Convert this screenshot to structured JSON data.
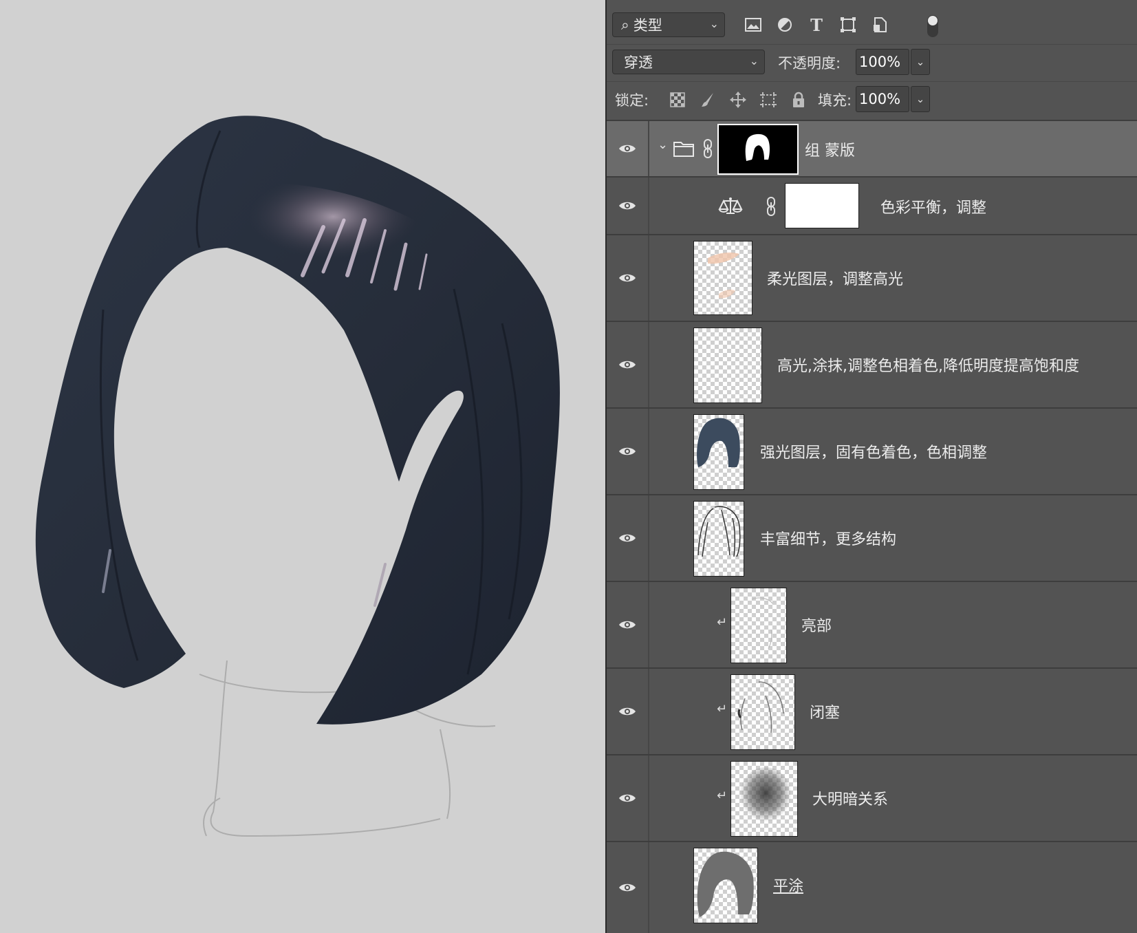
{
  "canvas": {
    "background": "#d1d1d1",
    "hair_color": "#2b3442"
  },
  "toolbar": {
    "filter_kind": "类型",
    "filter_icons": [
      "image-filter-icon",
      "adjustment-filter-icon",
      "type-filter-icon",
      "shape-filter-icon",
      "smart-object-filter-icon"
    ],
    "blend_mode": "穿透",
    "opacity_label": "不透明度:",
    "opacity_value": "100%",
    "lock_label": "锁定:",
    "fill_label": "填充:",
    "fill_value": "100%"
  },
  "layers": [
    {
      "name": "组 蒙版",
      "type": "group",
      "selected": true
    },
    {
      "name": "色彩平衡，调整",
      "type": "adjustment"
    },
    {
      "name": "柔光图层，调整高光",
      "type": "pixel"
    },
    {
      "name": "高光,涂抹,调整色相着色,降低明度提高饱和度",
      "type": "pixel"
    },
    {
      "name": "强光图层，固有色着色，色相调整",
      "type": "pixel"
    },
    {
      "name": "丰富细节，更多结构",
      "type": "pixel"
    },
    {
      "name": "亮部",
      "type": "clipped"
    },
    {
      "name": "闭塞",
      "type": "clipped"
    },
    {
      "name": "大明暗关系",
      "type": "clipped"
    },
    {
      "name": "平涂",
      "type": "pixel",
      "underlined": true
    }
  ],
  "colors": {
    "panel_bg": "#535353",
    "selected_bg": "#6b6b6b",
    "accent_skin": "#f0c4aa",
    "hair_blue": "#3c4b5e"
  }
}
